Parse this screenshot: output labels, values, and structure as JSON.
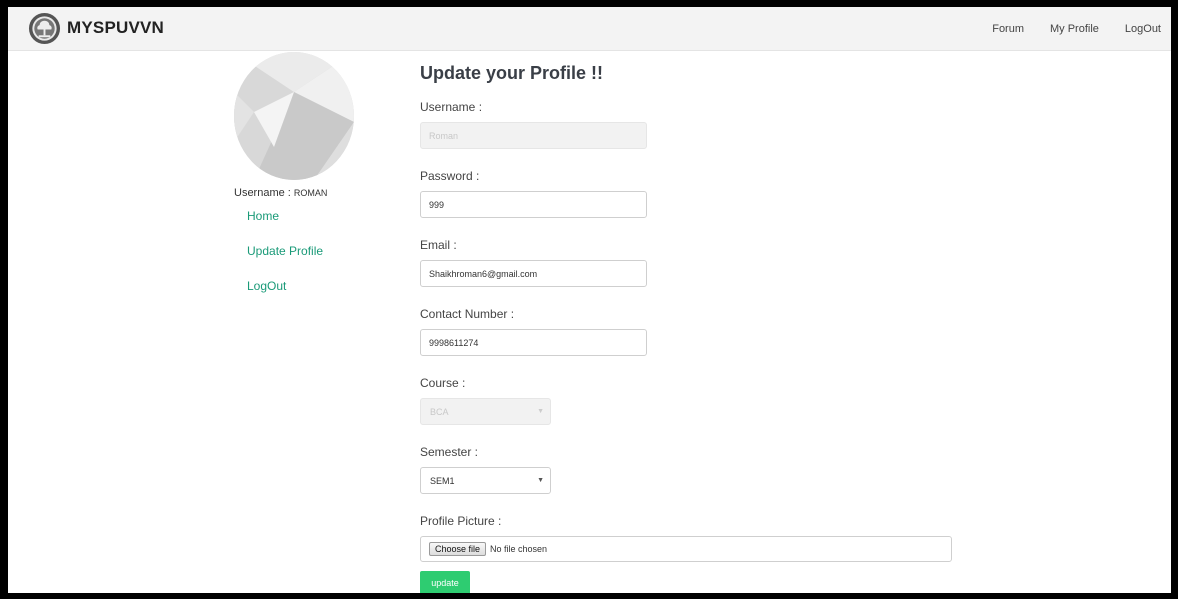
{
  "navbar": {
    "brand": "MYSPUVVN",
    "links": [
      "Forum",
      "My Profile",
      "LogOut"
    ]
  },
  "sidebar": {
    "username_label": "Username :",
    "username_value": "ROMAN",
    "items": [
      "Home",
      "Update Profile",
      "LogOut"
    ]
  },
  "form": {
    "title": "Update your Profile !!",
    "username": {
      "label": "Username :",
      "value": "Roman"
    },
    "password": {
      "label": "Password :",
      "value": "999"
    },
    "email": {
      "label": "Email :",
      "value": "Shaikhroman6@gmail.com"
    },
    "contact": {
      "label": "Contact Number :",
      "value": "9998611274"
    },
    "course": {
      "label": "Course :",
      "value": "BCA"
    },
    "semester": {
      "label": "Semester :",
      "value": "SEM1"
    },
    "picture": {
      "label": "Profile Picture :",
      "button": "Choose file",
      "status": "No file chosen"
    },
    "submit": "update"
  },
  "colors": {
    "accent_link": "#1a9a78",
    "submit_button": "#2ecc71",
    "navbar_bg": "#f3f3f3"
  }
}
